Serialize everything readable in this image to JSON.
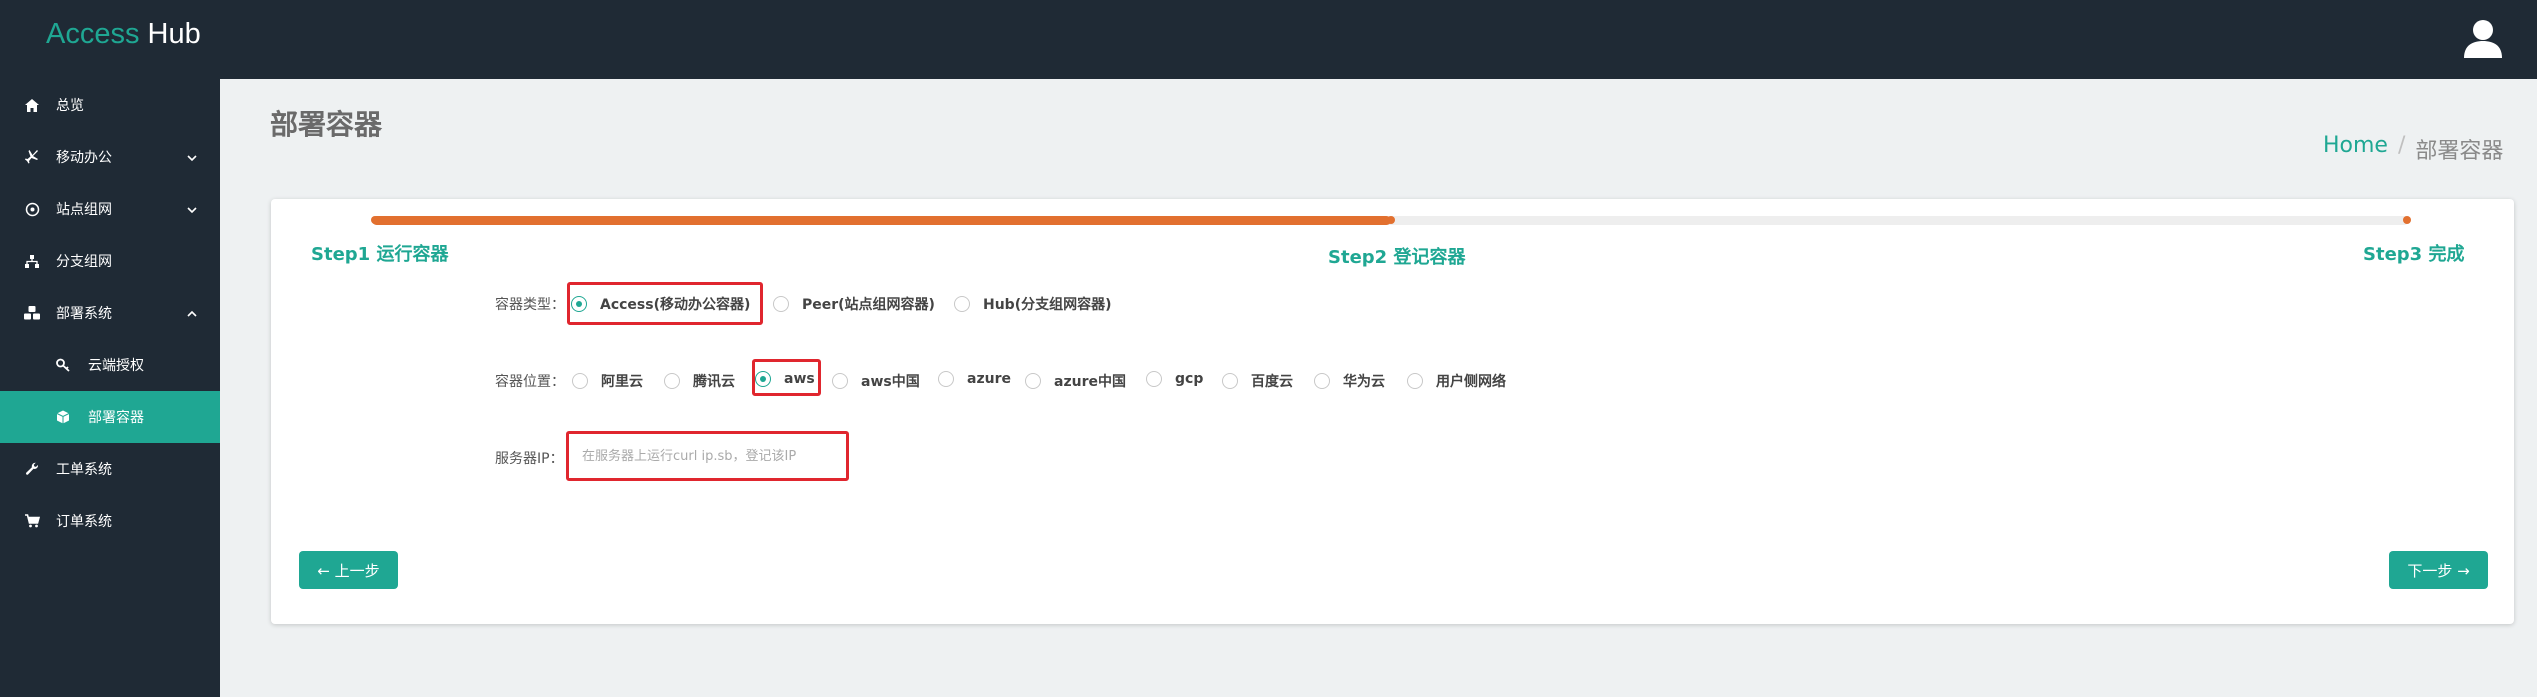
{
  "app": {
    "logo_first": "Access",
    "logo_second": "Hub"
  },
  "sidebar": {
    "items": [
      {
        "label": "总览",
        "icon": "home-icon"
      },
      {
        "label": "移动办公",
        "icon": "plane-icon",
        "expanded": false
      },
      {
        "label": "站点组网",
        "icon": "network-icon",
        "expanded": false
      },
      {
        "label": "分支组网",
        "icon": "sitemap-icon"
      },
      {
        "label": "部署系统",
        "icon": "cubes-icon",
        "expanded": true
      },
      {
        "label": "云端授权",
        "icon": "key-icon"
      },
      {
        "label": "部署容器",
        "icon": "cube-icon",
        "active": true
      },
      {
        "label": "工单系统",
        "icon": "wrench-icon"
      },
      {
        "label": "订单系统",
        "icon": "cart-icon"
      }
    ]
  },
  "page": {
    "title": "部署容器",
    "breadcrumb": {
      "home": "Home",
      "separator": "/",
      "current": "部署容器"
    }
  },
  "steps": {
    "labels": [
      "Step1 运行容器",
      "Step2 登记容器",
      "Step3 完成"
    ],
    "progress_fraction": 0.5
  },
  "form": {
    "container_type": {
      "label": "容器类型：",
      "options": [
        "Access(移动办公容器)",
        "Peer(站点组网容器)",
        "Hub(分支组网容器)"
      ],
      "selected": "Access(移动办公容器)"
    },
    "container_location": {
      "label": "容器位置：",
      "options": [
        "阿里云",
        "腾讯云",
        "aws",
        "aws中国",
        "azure",
        "azure中国",
        "gcp",
        "百度云",
        "华为云",
        "用户侧网络"
      ],
      "selected": "aws"
    },
    "server_ip": {
      "label": "服务器IP：",
      "value": "",
      "placeholder": "在服务器上运行curl ip.sb，登记该IP"
    }
  },
  "buttons": {
    "prev": "← 上一步",
    "next": "下一步 →"
  },
  "colors": {
    "accent": "#1fa793",
    "progress": "#e2702f",
    "highlight": "#e0262e",
    "sidebar_bg": "#1f2a35"
  }
}
